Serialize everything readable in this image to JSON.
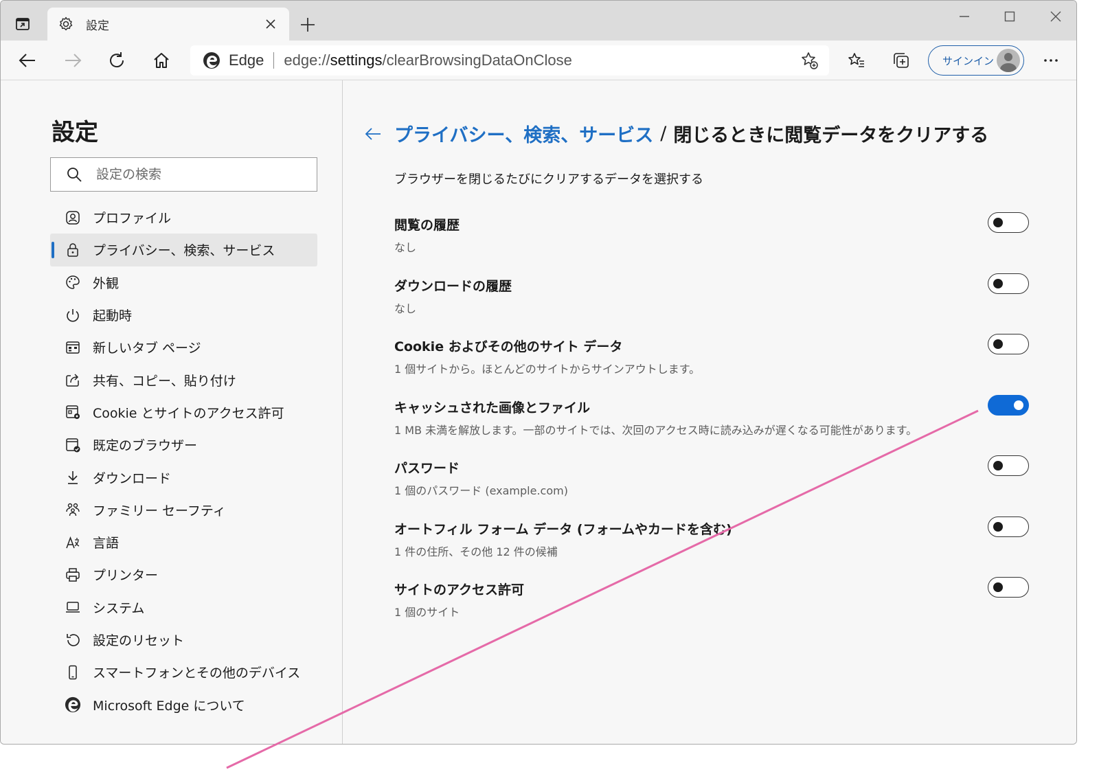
{
  "browser": {
    "tab_title": "設定",
    "address_site": "Edge",
    "address_url_prefix": "edge://",
    "address_url_strong": "settings",
    "address_url_suffix": "/clearBrowsingDataOnClose",
    "signin_label": "サインイン"
  },
  "sidebar": {
    "title": "設定",
    "search_placeholder": "設定の検索",
    "items": [
      {
        "label": "プロファイル",
        "icon": "profile-icon"
      },
      {
        "label": "プライバシー、検索、サービス",
        "icon": "lock-icon",
        "active": true
      },
      {
        "label": "外観",
        "icon": "palette-icon"
      },
      {
        "label": "起動時",
        "icon": "power-icon"
      },
      {
        "label": "新しいタブ ページ",
        "icon": "newtab-page-icon"
      },
      {
        "label": "共有、コピー、貼り付け",
        "icon": "share-icon"
      },
      {
        "label": "Cookie とサイトのアクセス許可",
        "icon": "site-permissions-icon"
      },
      {
        "label": "既定のブラウザー",
        "icon": "default-browser-icon"
      },
      {
        "label": "ダウンロード",
        "icon": "download-icon"
      },
      {
        "label": "ファミリー セーフティ",
        "icon": "family-icon"
      },
      {
        "label": "言語",
        "icon": "language-icon"
      },
      {
        "label": "プリンター",
        "icon": "printer-icon"
      },
      {
        "label": "システム",
        "icon": "laptop-icon"
      },
      {
        "label": "設定のリセット",
        "icon": "reset-icon"
      },
      {
        "label": "スマートフォンとその他のデバイス",
        "icon": "phone-icon"
      },
      {
        "label": "Microsoft Edge について",
        "icon": "edge-logo-icon"
      }
    ]
  },
  "main": {
    "breadcrumb_parent": "プライバシー、検索、サービス",
    "breadcrumb_separator": "/",
    "title": "閉じるときに閲覧データをクリアする",
    "subtitle": "ブラウザーを閉じるたびにクリアするデータを選択する",
    "rows": [
      {
        "title": "閲覧の履歴",
        "desc": "なし",
        "on": false
      },
      {
        "title": "ダウンロードの履歴",
        "desc": "なし",
        "on": false
      },
      {
        "title": "Cookie およびその他のサイト データ",
        "desc": "1 個サイトから。ほとんどのサイトからサインアウトします。",
        "on": false
      },
      {
        "title": "キャッシュされた画像とファイル",
        "desc": "1 MB 未満を解放します。一部のサイトでは、次回のアクセス時に読み込みが遅くなる可能性があります。",
        "on": true
      },
      {
        "title": "パスワード",
        "desc": "1 個のパスワード (example.com)",
        "on": false
      },
      {
        "title": "オートフィル フォーム データ (フォームやカードを含む)",
        "desc": "1 件の住所、その他 12 件の候補",
        "on": false
      },
      {
        "title": "サイトのアクセス許可",
        "desc": "1 個のサイト",
        "on": false
      }
    ]
  },
  "colors": {
    "accent": "#1f6fc4",
    "toggle_on": "#0f6ad6",
    "annotation_line": "#e56aa8"
  }
}
